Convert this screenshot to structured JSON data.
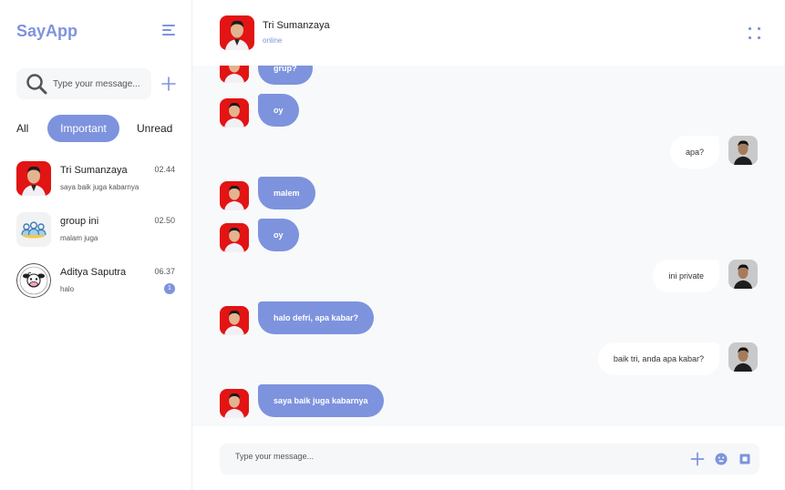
{
  "app": {
    "brand": "SayApp"
  },
  "sidebar": {
    "search_placeholder": "Type your message...",
    "filters": {
      "all": "All",
      "important": "Important",
      "unread": "Unread"
    },
    "contacts": [
      {
        "name": "Tri Sumanzaya",
        "time": "02.44",
        "preview": "saya baik juga kabarnya"
      },
      {
        "name": "group ini",
        "time": "02.50",
        "preview": "malam juga"
      },
      {
        "name": "Aditya Saputra",
        "time": "06.37",
        "preview": "halo",
        "unread": "1"
      }
    ]
  },
  "chat": {
    "contact_name": "Tri Sumanzaya",
    "status": "online",
    "messages": [
      {
        "side": "in",
        "text": "grup?"
      },
      {
        "side": "in",
        "text": "oy"
      },
      {
        "side": "out",
        "text": "apa?"
      },
      {
        "side": "in",
        "text": "malem"
      },
      {
        "side": "in",
        "text": "oy"
      },
      {
        "side": "out",
        "text": "ini private"
      },
      {
        "side": "in",
        "text": "halo defri, apa kabar?"
      },
      {
        "side": "out",
        "text": "baik tri, anda apa kabar?"
      },
      {
        "side": "in",
        "text": "saya baik juga kabarnya"
      }
    ],
    "composer_placeholder": "Type your message..."
  },
  "colors": {
    "accent": "#7d93dd",
    "chat_bg": "#f8f9fb",
    "input_bg": "#f6f7f9"
  },
  "icons": {
    "menu": "menu-icon",
    "search": "search-icon",
    "add": "plus-icon",
    "more": "dots-grid-icon",
    "emoji": "emoji-icon",
    "attach": "square-icon"
  }
}
